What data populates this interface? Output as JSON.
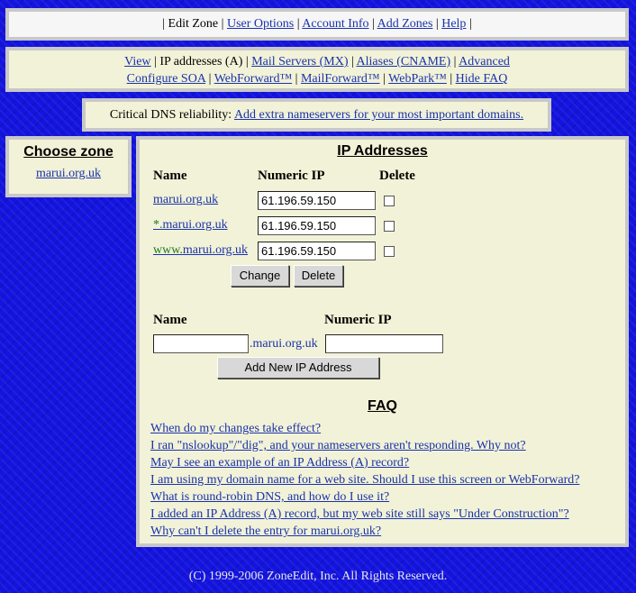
{
  "topnav": {
    "current": "Edit Zone",
    "links": [
      "User Options",
      "Account Info",
      "Add Zones",
      "Help"
    ]
  },
  "subnav": {
    "view": "View",
    "current": "IP addresses (A)",
    "mail_servers": "Mail Servers (MX)",
    "aliases": "Aliases (CNAME)",
    "advanced": "Advanced",
    "configure_soa": "Configure SOA",
    "webforward": "WebForward™",
    "mailforward": "MailForward™",
    "webpark": "WebPark™",
    "hide_faq": "Hide FAQ"
  },
  "promo": {
    "label": "Critical DNS reliability:",
    "link": "Add extra nameservers for your most important domains."
  },
  "zone": {
    "title": "Choose zone",
    "domain": "marui.org.uk"
  },
  "ip": {
    "title": "IP Addresses",
    "col_name": "Name",
    "col_ip": "Numeric IP",
    "col_delete": "Delete",
    "rows": [
      {
        "prefix": "",
        "name": "marui.org.uk",
        "ip": "61.196.59.150"
      },
      {
        "prefix": "*.",
        "name": "marui.org.uk",
        "ip": "61.196.59.150"
      },
      {
        "prefix": "www.",
        "name": "marui.org.uk",
        "ip": "61.196.59.150"
      }
    ],
    "change_btn": "Change",
    "delete_btn": "Delete"
  },
  "add": {
    "col_name": "Name",
    "col_ip": "Numeric IP",
    "suffix": ".marui.org.uk",
    "name_value": "",
    "ip_value": "",
    "button": "Add New IP Address"
  },
  "faq": {
    "title": "FAQ",
    "items": [
      "When do my changes take effect?",
      "I ran \"nslookup\"/\"dig\", and your nameservers aren't responding. Why not?",
      "May I see an example of an IP Address (A) record?",
      "I am using my domain name for a web site. Should I use this screen or WebForward?",
      "What is round-robin DNS, and how do I use it?",
      "I added an IP Address (A) record, but my web site still says \"Under Construction\"?",
      "Why can't I delete the entry for marui.org.uk?"
    ]
  },
  "footer": "(C) 1999-2006 ZoneEdit, Inc. All Rights Reserved."
}
